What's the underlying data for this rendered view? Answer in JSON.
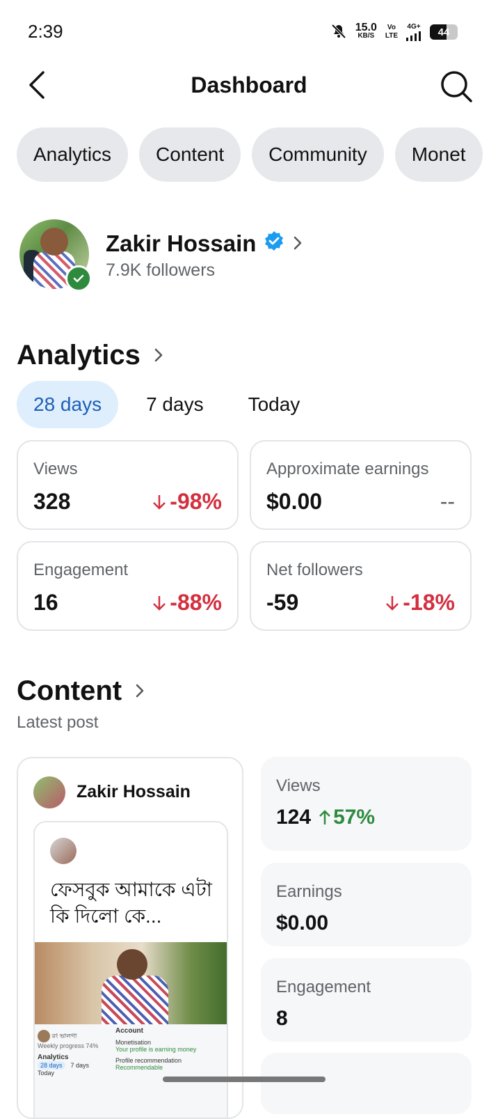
{
  "status_bar": {
    "time": "2:39",
    "net_speed": "15.0",
    "net_unit": "KB/S",
    "volte_top": "Vo",
    "volte_bottom": "LTE",
    "network": "4G+",
    "battery": "44"
  },
  "header": {
    "title": "Dashboard",
    "back_icon": "chevron-left-icon",
    "search_icon": "search-icon"
  },
  "tabs": [
    "Analytics",
    "Content",
    "Community",
    "Monet"
  ],
  "profile": {
    "name": "Zakir Hossain",
    "followers": "7.9K followers"
  },
  "analytics": {
    "title": "Analytics",
    "ranges": [
      "28 days",
      "7 days",
      "Today"
    ],
    "active_range": "28 days",
    "cards": [
      {
        "label": "Views",
        "value": "328",
        "change": "-98%",
        "trend": "down"
      },
      {
        "label": "Approximate earnings",
        "value": "$0.00",
        "change": "--",
        "trend": "none"
      },
      {
        "label": "Engagement",
        "value": "16",
        "change": "-88%",
        "trend": "down"
      },
      {
        "label": "Net followers",
        "value": "-59",
        "change": "-18%",
        "trend": "down"
      }
    ]
  },
  "content": {
    "title": "Content",
    "subtitle": "Latest post",
    "post": {
      "author": "Zakir Hossain",
      "text": "ফেসবুক আমাকে এটা কি দিলো কে...",
      "mini": {
        "name": "রং ভালগা",
        "progress": "Weekly progress 74%",
        "analytics": "Analytics",
        "tabs": [
          "28 days",
          "7 days",
          "Today"
        ],
        "account": "Account",
        "monetisation": "Monetisation",
        "monetisation_sub": "Your profile is earning money",
        "recommendation": "Profile recommendation",
        "recommendation_sub": "Recommendable"
      }
    },
    "metrics": [
      {
        "label": "Views",
        "value": "124",
        "change": "57%",
        "trend": "up"
      },
      {
        "label": "Earnings",
        "value": "$0.00"
      },
      {
        "label": "Engagement",
        "value": "8"
      }
    ]
  },
  "colors": {
    "negative": "#d32f3f",
    "positive": "#2e8b3e",
    "active_tab_bg": "#dfeefc",
    "active_tab_text": "#1d5fb8",
    "verified_blue": "#1d9bf0"
  }
}
